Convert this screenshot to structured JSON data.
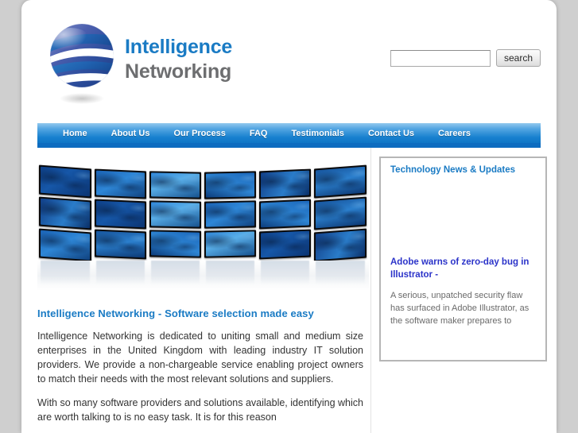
{
  "brand": {
    "line1": "Intelligence",
    "line2": "Networking",
    "logo_icon": "globe-swoosh-logo",
    "color_primary": "#1a7bc4",
    "color_secondary": "#6d6e70"
  },
  "search": {
    "value": "",
    "placeholder": "",
    "button_label": "search"
  },
  "nav": {
    "items": [
      {
        "label": "Home"
      },
      {
        "label": "About Us"
      },
      {
        "label": "Our Process"
      },
      {
        "label": "FAQ"
      },
      {
        "label": "Testimonials"
      },
      {
        "label": "Contact Us"
      },
      {
        "label": "Careers"
      }
    ]
  },
  "hero": {
    "alt": "video-wall-of-blue-world-map-monitors"
  },
  "main": {
    "heading": "Intelligence Networking - Software selection made easy",
    "paragraph1": "Intelligence Networking is dedicated to uniting small and medium size enterprises in the United Kingdom with leading industry IT solution providers. We provide a non-chargeable service enabling project owners to match their needs with the most relevant solutions and suppliers.",
    "paragraph2": "With so many software providers and solutions available, identifying which are worth talking to is no easy task. It is for this reason"
  },
  "sidebar": {
    "news_title": "Technology News & Updates",
    "news_items": [
      {
        "headline": "Adobe warns of zero-day bug in Illustrator -",
        "body": "A serious, unpatched security flaw has surfaced in Adobe Illustrator, as the software maker prepares to"
      }
    ]
  }
}
